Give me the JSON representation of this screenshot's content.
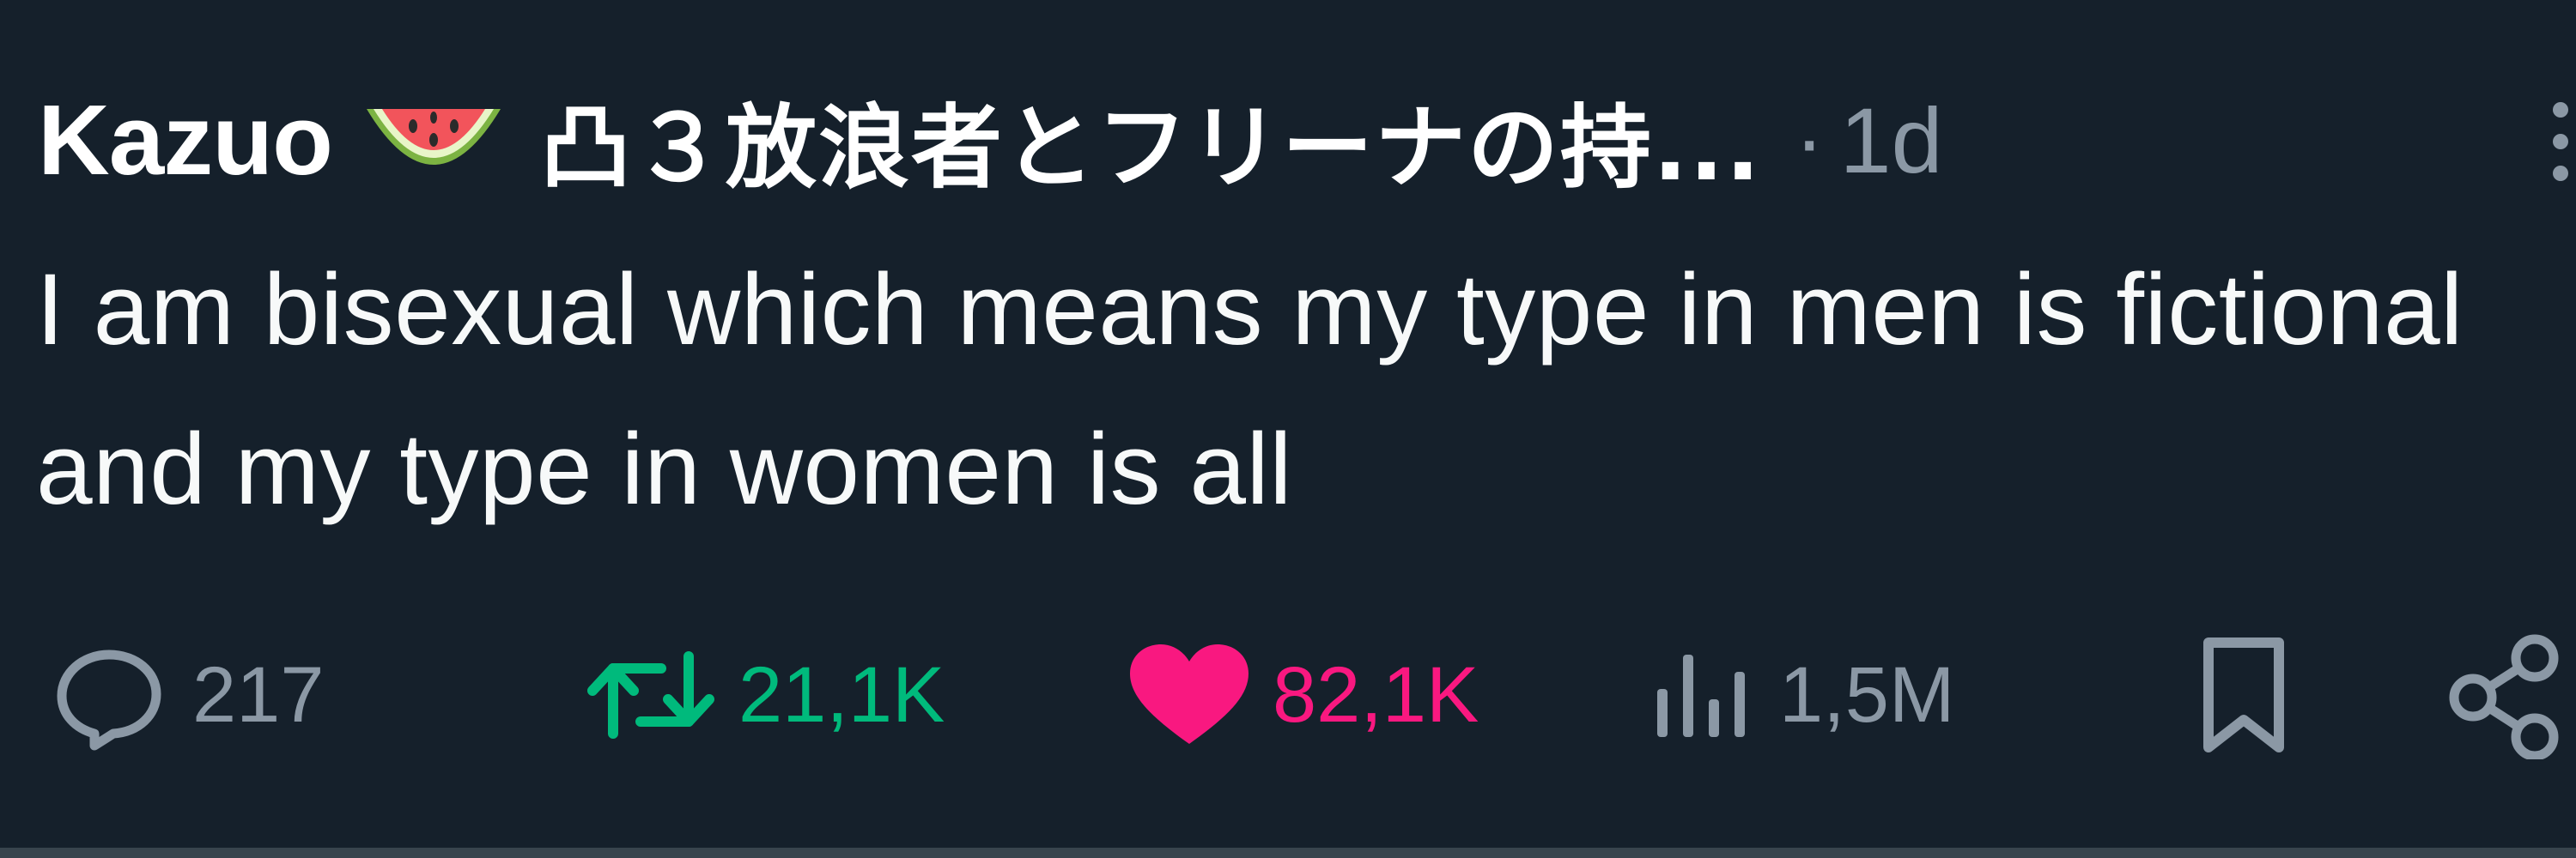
{
  "author": {
    "name": "Kazuo",
    "emoji": "watermelon-icon",
    "handle_rest": "凸３放浪者とフリーナの持...",
    "separator": "·",
    "time": "1d"
  },
  "tweet": {
    "text": "I am bisexual which means my type in men is fictional and my type in women is all"
  },
  "actions": {
    "replies": "217",
    "retweets": "21,1K",
    "likes": "82,1K",
    "views": "1,5M"
  },
  "colors": {
    "background": "#15202b",
    "muted": "#8b98a5",
    "retweet_active": "#00ba7c",
    "like_active": "#f91880"
  }
}
